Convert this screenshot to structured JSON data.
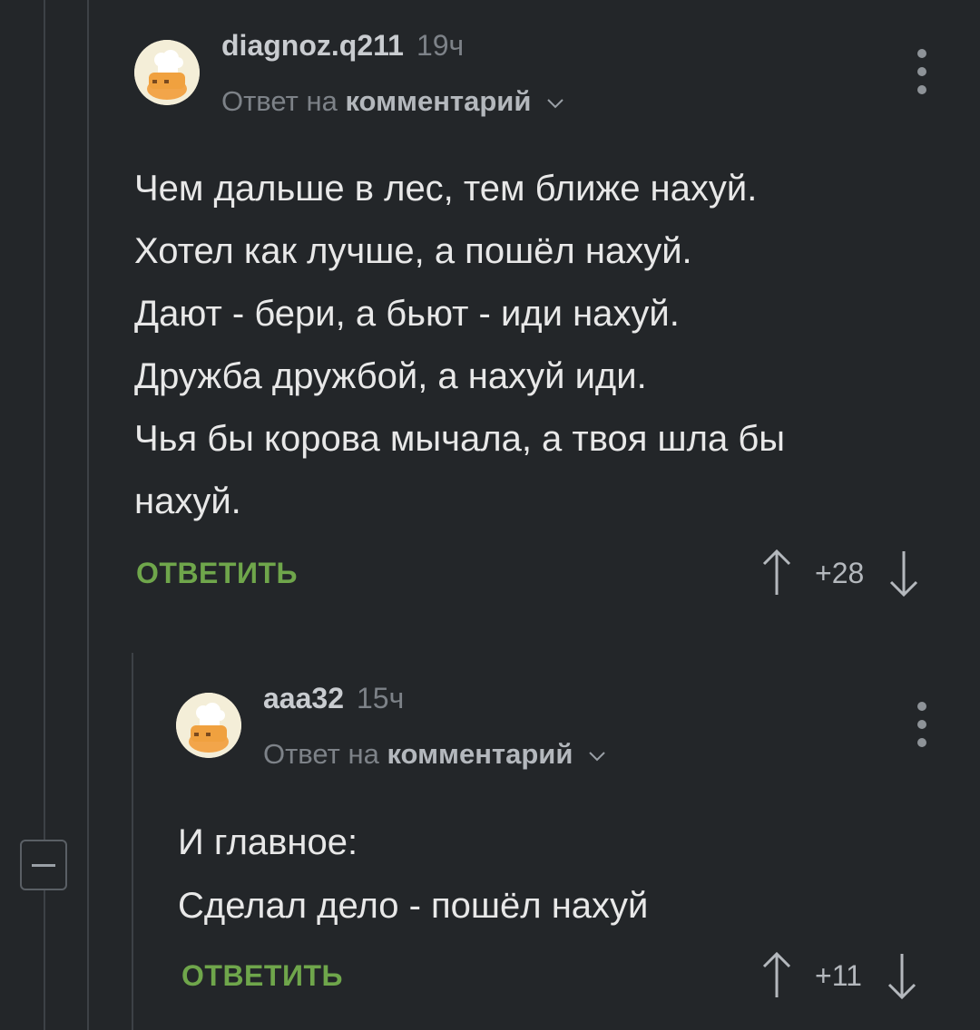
{
  "comments": [
    {
      "username": "diagnoz.q211",
      "time": "19ч",
      "reply_prefix": "Ответ на",
      "reply_target": "комментарий",
      "lines": [
        "Чем дальше в лес, тем ближе нахуй.",
        "Хотел как лучше, а пошёл нахуй.",
        "Дают - бери, а бьют - иди нахуй.",
        "Дружба дружбой, а нахуй иди.",
        "Чья бы корова мычала, а твоя шла бы",
        "нахуй."
      ],
      "reply_label": "ОТВЕТИТЬ",
      "score": "+28"
    },
    {
      "username": "aaa32",
      "time": "15ч",
      "reply_prefix": "Ответ на",
      "reply_target": "комментарий",
      "lines": [
        "И главное:",
        "Сделал дело - пошёл нахуй"
      ],
      "reply_label": "ОТВЕТИТЬ",
      "score": "+11"
    }
  ],
  "colors": {
    "background": "#232629",
    "accent_green": "#6fa64b",
    "muted": "#7d8288"
  },
  "icons": {
    "avatar": "chef-hat-cake-avatar",
    "menu": "kebab-menu-icon",
    "upvote": "arrow-up-icon",
    "downvote": "arrow-down-icon",
    "collapse": "collapse-minus-icon"
  }
}
